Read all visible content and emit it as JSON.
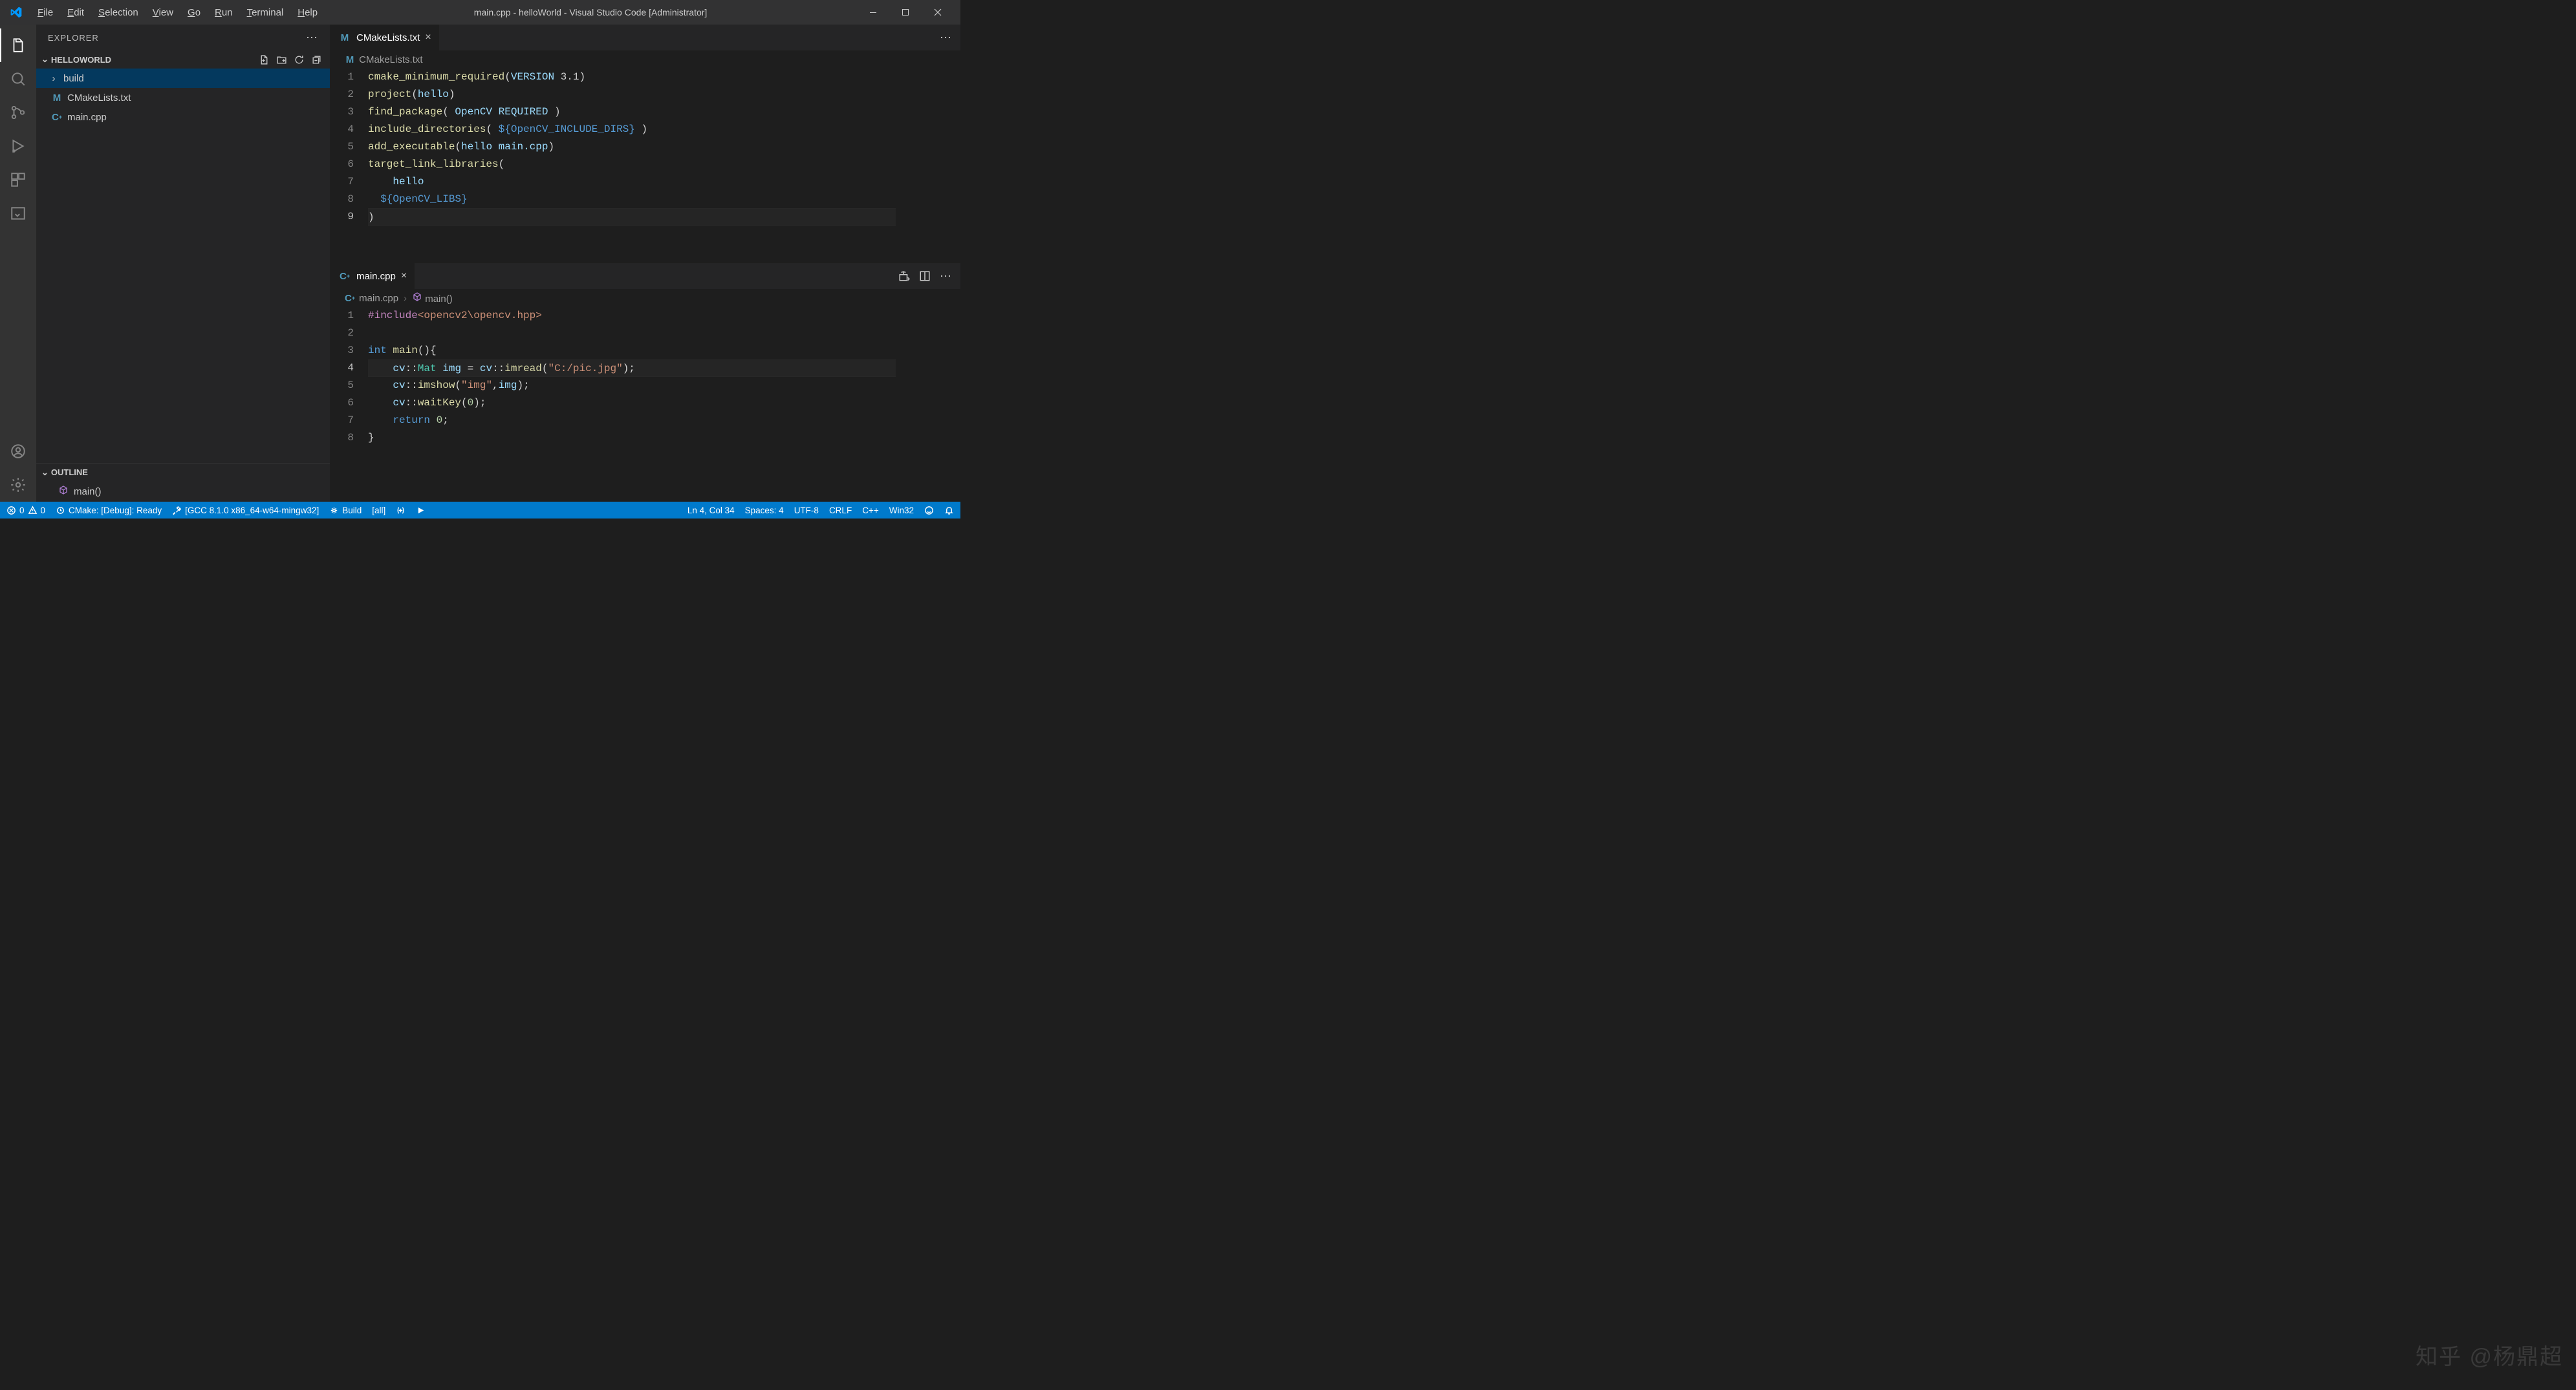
{
  "title": "main.cpp - helloWorld - Visual Studio Code [Administrator]",
  "menu": [
    "File",
    "Edit",
    "Selection",
    "View",
    "Go",
    "Run",
    "Terminal",
    "Help"
  ],
  "sidebar": {
    "header": "EXPLORER",
    "folder": "HELLOWORLD",
    "items": [
      {
        "type": "folder",
        "label": "build",
        "selected": true
      },
      {
        "type": "file",
        "icon": "M",
        "label": "CMakeLists.txt"
      },
      {
        "type": "file",
        "icon": "C+",
        "label": "main.cpp"
      }
    ],
    "outline_header": "OUTLINE",
    "outline_items": [
      {
        "label": "main()"
      }
    ]
  },
  "editors": [
    {
      "tab": {
        "icon": "M",
        "label": "CMakeLists.txt"
      },
      "breadcrumb": [
        {
          "icon": "M",
          "label": "CMakeLists.txt"
        }
      ],
      "currentLine": 9,
      "lines": [
        [
          [
            "fn",
            "cmake_minimum_required"
          ],
          [
            "pn",
            "("
          ],
          [
            "id",
            "VERSION"
          ],
          [
            "pn",
            " 3.1)"
          ]
        ],
        [
          [
            "fn",
            "project"
          ],
          [
            "pn",
            "("
          ],
          [
            "id",
            "hello"
          ],
          [
            "pn",
            ")"
          ]
        ],
        [
          [
            "fn",
            "find_package"
          ],
          [
            "pn",
            "( "
          ],
          [
            "id",
            "OpenCV"
          ],
          [
            "pn",
            " "
          ],
          [
            "id",
            "REQUIRED"
          ],
          [
            "pn",
            " )"
          ]
        ],
        [
          [
            "fn",
            "include_directories"
          ],
          [
            "pn",
            "( "
          ],
          [
            "mac",
            "${OpenCV_INCLUDE_DIRS}"
          ],
          [
            "pn",
            " )"
          ]
        ],
        [
          [
            "fn",
            "add_executable"
          ],
          [
            "pn",
            "("
          ],
          [
            "id",
            "hello"
          ],
          [
            "pn",
            " "
          ],
          [
            "id",
            "main.cpp"
          ],
          [
            "pn",
            ")"
          ]
        ],
        [
          [
            "fn",
            "target_link_libraries"
          ],
          [
            "pn",
            "("
          ]
        ],
        [
          [
            "pn",
            "    "
          ],
          [
            "id",
            "hello"
          ]
        ],
        [
          [
            "pn",
            "  "
          ],
          [
            "mac",
            "${OpenCV_LIBS}"
          ]
        ],
        [
          [
            "pn",
            ")"
          ]
        ]
      ]
    },
    {
      "tab": {
        "icon": "C+",
        "label": "main.cpp"
      },
      "breadcrumb": [
        {
          "icon": "C+",
          "label": "main.cpp"
        },
        {
          "icon": "cube",
          "label": "main()"
        }
      ],
      "currentLine": 4,
      "lines": [
        [
          [
            "dir",
            "#include"
          ],
          [
            "str",
            "<opencv2\\opencv.hpp>"
          ]
        ],
        [],
        [
          [
            "kw",
            "int"
          ],
          [
            "pn",
            " "
          ],
          [
            "fn",
            "main"
          ],
          [
            "pn",
            "(){"
          ]
        ],
        [
          [
            "pn",
            "    "
          ],
          [
            "id",
            "cv"
          ],
          [
            "pn",
            "::"
          ],
          [
            "ns",
            "Mat"
          ],
          [
            "pn",
            " "
          ],
          [
            "id",
            "img"
          ],
          [
            "pn",
            " = "
          ],
          [
            "id",
            "cv"
          ],
          [
            "pn",
            "::"
          ],
          [
            "fn",
            "imread"
          ],
          [
            "pn",
            "("
          ],
          [
            "str",
            "\"C:/pic.jpg\""
          ],
          [
            "pn",
            ");"
          ]
        ],
        [
          [
            "pn",
            "    "
          ],
          [
            "id",
            "cv"
          ],
          [
            "pn",
            "::"
          ],
          [
            "fn",
            "imshow"
          ],
          [
            "pn",
            "("
          ],
          [
            "str",
            "\"img\""
          ],
          [
            "pn",
            ","
          ],
          [
            "id",
            "img"
          ],
          [
            "pn",
            ");"
          ]
        ],
        [
          [
            "pn",
            "    "
          ],
          [
            "id",
            "cv"
          ],
          [
            "pn",
            "::"
          ],
          [
            "fn",
            "waitKey"
          ],
          [
            "pn",
            "("
          ],
          [
            "num",
            "0"
          ],
          [
            "pn",
            ");"
          ]
        ],
        [
          [
            "pn",
            "    "
          ],
          [
            "kw",
            "return"
          ],
          [
            "pn",
            " "
          ],
          [
            "num",
            "0"
          ],
          [
            "pn",
            ";"
          ]
        ],
        [
          [
            "pn",
            "}"
          ]
        ]
      ]
    }
  ],
  "status": {
    "errors": "0",
    "warnings": "0",
    "cmake": "CMake: [Debug]: Ready",
    "kit": "[GCC 8.1.0 x86_64-w64-mingw32]",
    "build": "Build",
    "target": "[all]",
    "cursor": "Ln 4, Col 34",
    "spaces": "Spaces: 4",
    "encoding": "UTF-8",
    "eol": "CRLF",
    "lang": "C++",
    "os": "Win32"
  },
  "watermark": "知乎 @杨鼎超"
}
